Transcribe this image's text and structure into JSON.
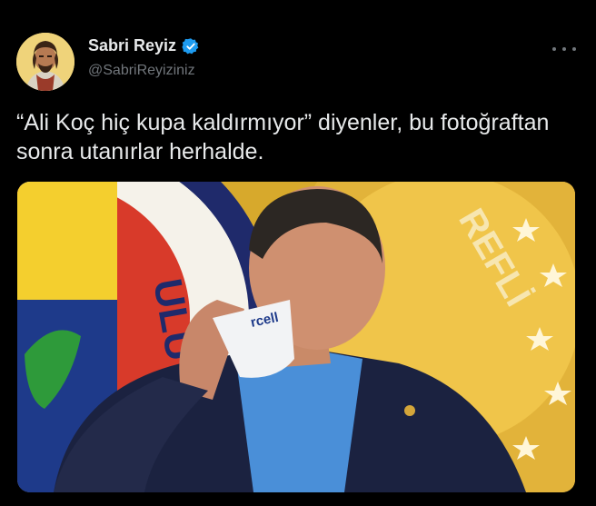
{
  "tweet": {
    "author_name": "Sabri Reyiz",
    "author_handle": "@SabriReyiziniz",
    "text": "“Ali Koç hiç kupa kaldırmıyor” diyenler, bu fotoğraftan sonra utanırlar herhalde.",
    "media_mug_text": "rcell",
    "media_logo_left_text": "ULÜ",
    "media_logo_right_text": "REFLİ"
  },
  "icons": {
    "verified": "verified-badge-icon",
    "more": "more-options-icon"
  },
  "colors": {
    "background": "#000000",
    "text_primary": "#e7e9ea",
    "text_secondary": "#71767b",
    "verified": "#1d9bf0"
  }
}
